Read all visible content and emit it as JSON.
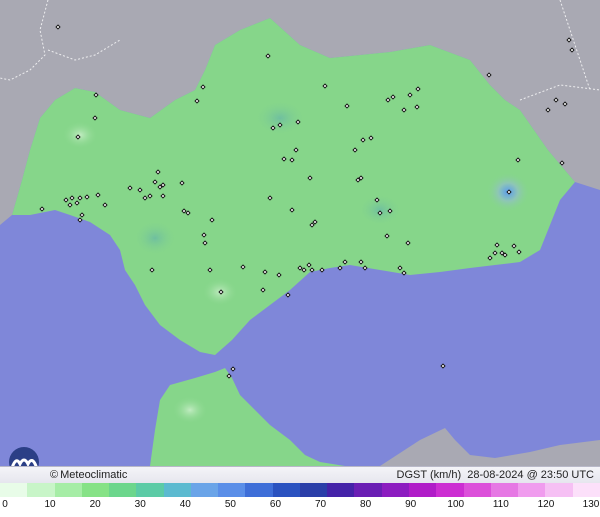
{
  "map": {
    "footer": {
      "brand": "Meteoclimatic",
      "copyright_symbol": "©",
      "variable": "DGST (km/h)",
      "datetime": "28-08-2024 @ 23:50 UTC"
    },
    "legend": {
      "ticks": [
        "0",
        "10",
        "20",
        "30",
        "40",
        "50",
        "60",
        "70",
        "80",
        "90",
        "100",
        "110",
        "120",
        "130"
      ],
      "colors": [
        "#e8fce8",
        "#c8f5c8",
        "#a6eda6",
        "#86e286",
        "#6cd68c",
        "#5ccba6",
        "#5cbad0",
        "#6aa4e8",
        "#5a8ee8",
        "#3e6ed8",
        "#2a52c0",
        "#2a3ea8",
        "#4422a8",
        "#6a1eb4",
        "#8c1cc0",
        "#b01cc8",
        "#cc2ed2",
        "#dc50da",
        "#e678e4",
        "#f09cee",
        "#f6c0f4",
        "#fce0fa"
      ]
    },
    "colors": {
      "sea": "#7f87d9",
      "land": "#86d68a",
      "outside_land": "#a9a9b3",
      "gust_hotspot": "#66a4ea"
    },
    "station_marker": "diamond"
  }
}
